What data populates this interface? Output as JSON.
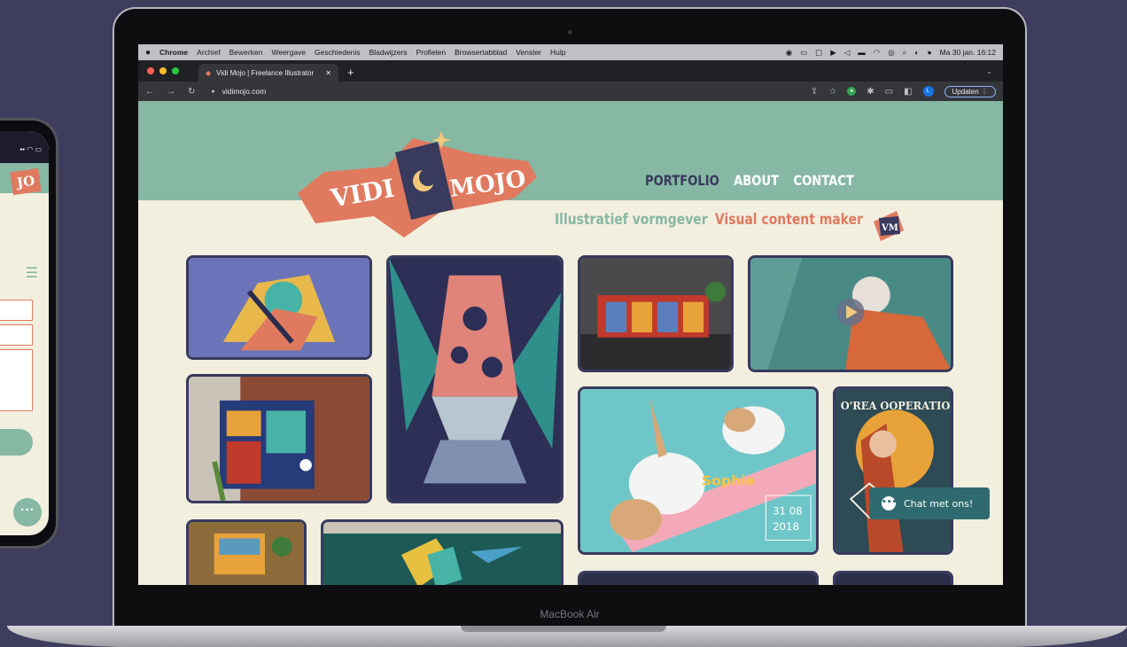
{
  "menubar": {
    "apple_icon": "apple-icon",
    "app": "Chrome",
    "items": [
      "Archief",
      "Bewerken",
      "Weergave",
      "Geschiedenis",
      "Bladwijzers",
      "Profielen",
      "Browsertabblad",
      "Venster",
      "Hulp"
    ],
    "clock": "Ma 30 jan. 16:12"
  },
  "browser": {
    "tab_title": "Vidi Mojo | Freelance Illustrator",
    "url": "vidimojo.com",
    "update_label": "Updaten",
    "avatar_initial": "L"
  },
  "site": {
    "logo_left": "VIDI",
    "logo_right": "MOJO",
    "nav": {
      "portfolio": "PORTFOLIO",
      "about": "ABOUT",
      "contact": "CONTACT"
    },
    "tagline_1": "Illustratief vormgever",
    "tagline_2": "Visual content maker",
    "badge": "VM",
    "cards": {
      "rabbit_name": "Sophie",
      "rabbit_date_1": "31 08",
      "rabbit_date_2": "2018",
      "poster_text": "O'REA OOPERATION"
    },
    "chat_label": "Chat met ons!"
  },
  "phone": {
    "logo": "JO"
  },
  "laptop_label": "MacBook Air",
  "colors": {
    "teal": "#86b8a4",
    "coral": "#e07a5f",
    "navy": "#383a5e",
    "cream": "#f3efdf",
    "background": "#3e3d5e",
    "chat": "#2e6a70"
  }
}
